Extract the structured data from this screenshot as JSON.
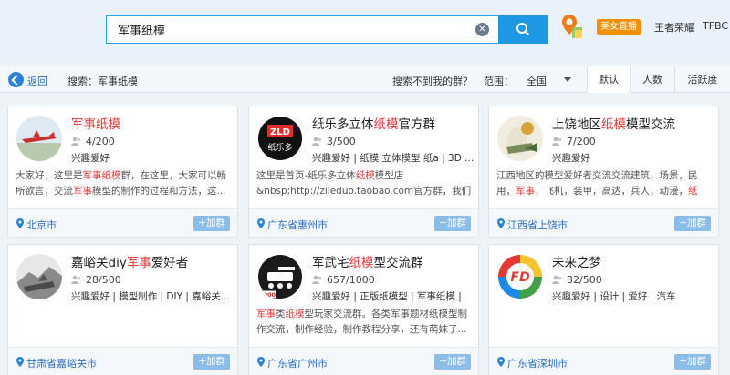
{
  "header": {
    "search_value": "军事纸模",
    "live_badge": "美女直播",
    "links": [
      "王者荣耀",
      "TFBC"
    ]
  },
  "subbar": {
    "back": "返回",
    "search_summary": "搜索：军事纸模",
    "cant_find": "搜索不到我的群？",
    "range_label": "范围：",
    "region": "全国",
    "sort_tabs": [
      "默认",
      "人数",
      "活跃度"
    ]
  },
  "colors": {
    "accent": "#1f98e3",
    "highlight": "#e33a3a",
    "live": "#f29100",
    "join": "#8bbde8"
  },
  "cards": [
    {
      "title_pre": "",
      "title_hl": "军事纸模",
      "title_post": "",
      "count": "4/200",
      "tags": "兴趣爱好",
      "desc": [
        "大家好，这里是",
        "军事纸模",
        "群，在这里，大家可以畅所欲言，交流",
        "军事",
        "模型的制作的过程和方法，这..."
      ],
      "location": "北京市",
      "join": "+加群"
    },
    {
      "title_pre": "纸乐多立体",
      "title_hl": "纸模",
      "title_post": "官方群",
      "count": "3/500",
      "tags": "兴趣爱好 | 纸模 立体模型 纸a | 3D ...",
      "desc": [
        "这里是首页-纸乐多立体",
        "纸模",
        "模型店&nbsp;http://zileduo.taobao.com官方群，我们欢迎所有的新...",
        "",
        ""
      ],
      "location": "广东省惠州市",
      "join": "+加群"
    },
    {
      "title_pre": "上饶地区",
      "title_hl": "纸模",
      "title_post": "模型交流",
      "count": "7/200",
      "tags": "兴趣爱好",
      "desc": [
        "江西地区的模型爱好者交流交流建筑，场景，民用，",
        "军事",
        "，飞机，装甲，高达，兵人，动漫，",
        "纸",
        ""
      ],
      "location": "江西省上饶市",
      "join": "+加群"
    },
    {
      "title_pre": "嘉峪关diy",
      "title_hl": "军事",
      "title_post": "爱好者",
      "count": "28/500",
      "tags": "兴趣爱好 | 模型制作 | DIY | 嘉峪关...",
      "desc": [
        "",
        "",
        "",
        "",
        ""
      ],
      "location": "甘肃省嘉峪关市",
      "join": "+加群"
    },
    {
      "title_pre": "军武宅",
      "title_hl": "纸模",
      "title_post": "型交流群",
      "count": "657/1000",
      "tags": "兴趣爱好 | 正版纸模型 | 军事纸模 |",
      "desc": [
        "",
        "军事",
        "类",
        "纸模",
        "型玩家交流群。各类军事题材纸模型制作交流，制作经验，制作教程分享，还有萌妹子..."
      ],
      "location": "广东省广州市",
      "join": "+加群"
    },
    {
      "title_pre": "未来之梦",
      "title_hl": "",
      "title_post": "",
      "count": "32/500",
      "tags": "兴趣爱好 | 设计 | 爱好 | 汽车",
      "desc": [
        "",
        "",
        "",
        "",
        ""
      ],
      "location": "广东省深圳市",
      "join": "+加群"
    }
  ],
  "avatar_texts": {
    "zld": "ZLD",
    "zld_sub": "纸乐多",
    "count_badge": "1000",
    "fd": "FD"
  }
}
